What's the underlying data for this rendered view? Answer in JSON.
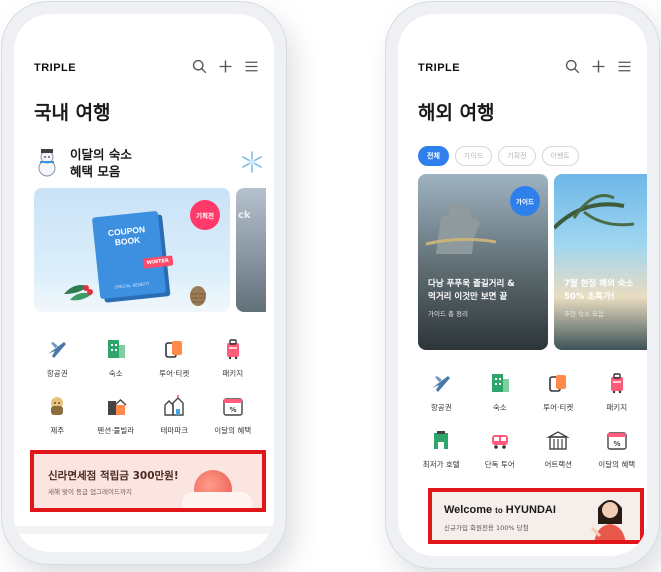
{
  "colors": {
    "accent_blue": "#2f80ed",
    "badge_pink": "#ff3a6a",
    "highlight_red": "#e0161b"
  },
  "left": {
    "brand": "TRIPLE",
    "title": "국내 여행",
    "promo": {
      "line1": "이달의 숙소",
      "line2": "혜택 모음"
    },
    "coupon": {
      "badge": "기획전",
      "book_title": "COUPON BOOK",
      "book_tag": "WINTER",
      "book_sub": "SPECIAL BENEFIT"
    },
    "peek_text": "ck",
    "categories": [
      {
        "label": "항공권",
        "icon": "airplane-icon"
      },
      {
        "label": "숙소",
        "icon": "hotel-icon"
      },
      {
        "label": "투어·티켓",
        "icon": "ticket-icon"
      },
      {
        "label": "패키지",
        "icon": "luggage-icon"
      },
      {
        "label": "제주",
        "icon": "jeju-icon"
      },
      {
        "label": "펜션·풀빌라",
        "icon": "pension-icon"
      },
      {
        "label": "테마파크",
        "icon": "themepark-icon"
      },
      {
        "label": "이달의 혜택",
        "icon": "calendar-discount-icon"
      }
    ],
    "banner": {
      "title": "신라면세점 적립금 300만원!",
      "subtitle": "새해 맞이 등급 업그레이드까지"
    }
  },
  "right": {
    "brand": "TRIPLE",
    "title": "해외 여행",
    "chips": [
      "전체",
      "가이드",
      "기획전",
      "이벤트"
    ],
    "card_a": {
      "badge": "가이드",
      "title_line1": "다낭 푸푸욱 즐길거리 &",
      "title_line2": "먹거리 이것만 보면 끝",
      "subtitle": "가이드 총 정리"
    },
    "card_b": {
      "title_line1": "7월 한정 해외 숙소",
      "title_line2": "50% 초특가!",
      "subtitle": "추천 숙소 모음"
    },
    "categories": [
      {
        "label": "항공권",
        "icon": "airplane-icon"
      },
      {
        "label": "숙소",
        "icon": "hotel-icon"
      },
      {
        "label": "투어·티켓",
        "icon": "ticket-icon"
      },
      {
        "label": "패키지",
        "icon": "luggage-icon"
      },
      {
        "label": "최저가 호텔",
        "icon": "lowest-hotel-icon"
      },
      {
        "label": "단독 투어",
        "icon": "private-tour-icon"
      },
      {
        "label": "어트랙션",
        "icon": "attraction-icon"
      },
      {
        "label": "이달의 혜택",
        "icon": "calendar-discount-icon"
      }
    ],
    "banner": {
      "title_main": "Welcome",
      "title_to": "to",
      "title_brand": "HYUNDAI",
      "subtitle": "신규가입 회원전용 100% 당첨"
    }
  }
}
